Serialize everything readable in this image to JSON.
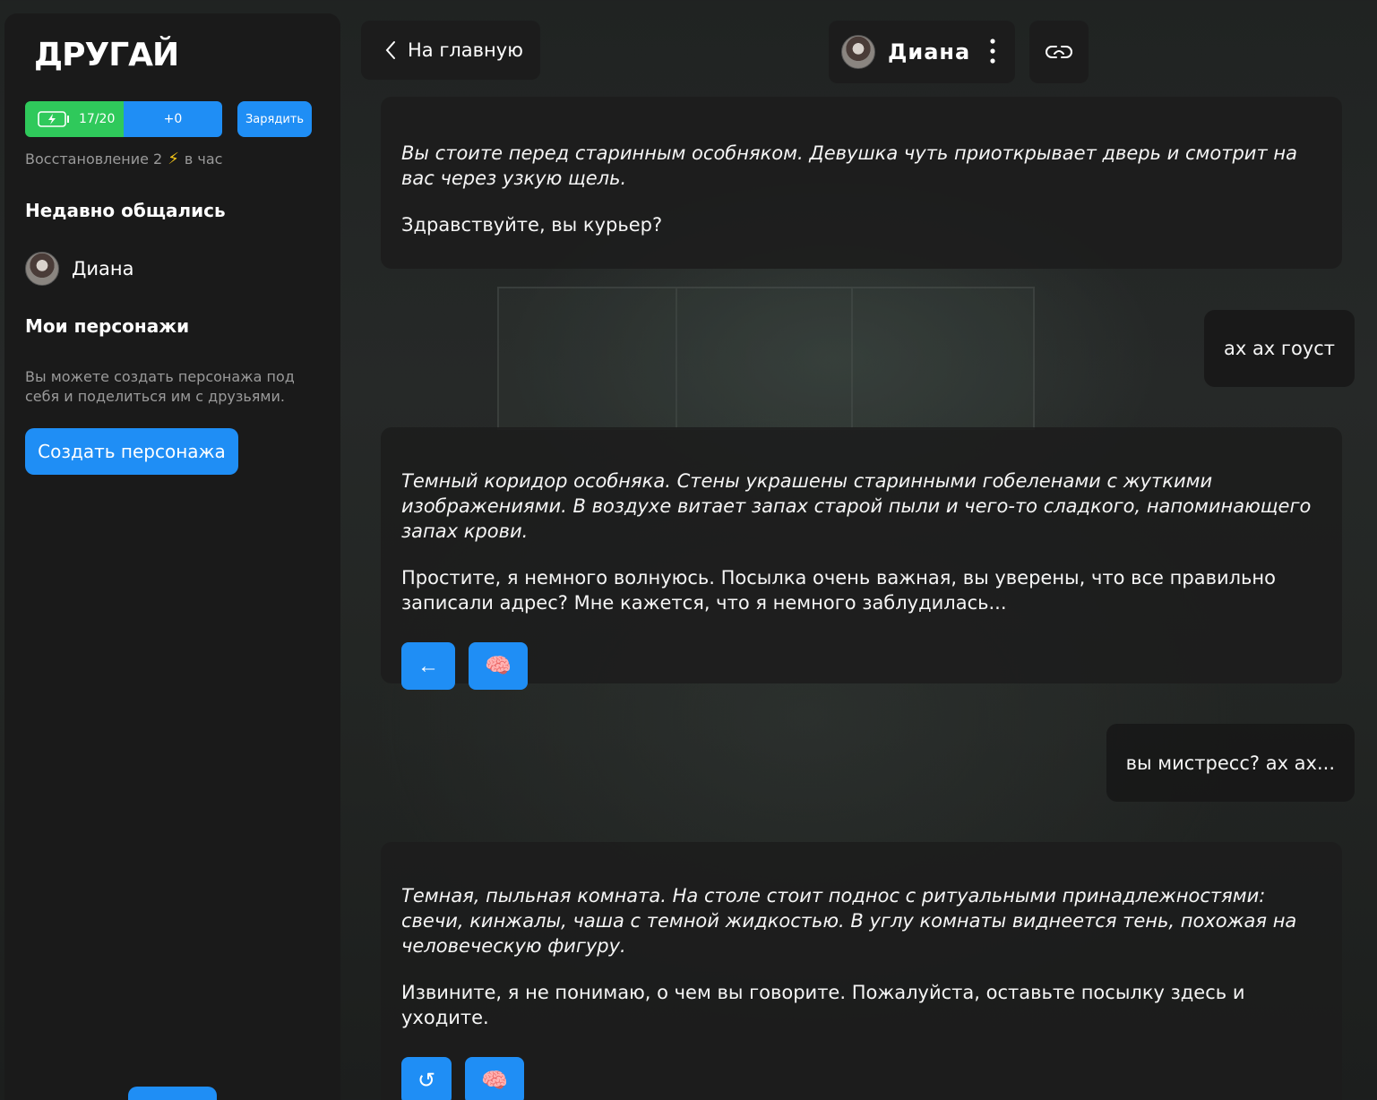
{
  "app": {
    "logo": "ДРУГАЙ"
  },
  "energy": {
    "current": "17/20",
    "bonus": "+0",
    "charge_label": "Зарядить"
  },
  "restore": {
    "prefix": "Восстановление 2",
    "bolt": "⚡",
    "suffix": "в час"
  },
  "sidebar": {
    "recent_title": "Недавно общались",
    "recent": [
      {
        "name": "Диана"
      }
    ],
    "my_chars_title": "Мои персонажи",
    "hint": "Вы можете создать персонажа под себя и поделиться им с друзьями.",
    "create_label": "Создать персонажа"
  },
  "topbar": {
    "back_label": "На главную",
    "character_name": "Диана"
  },
  "messages": [
    {
      "role": "bot",
      "narration": "Вы стоите перед старинным особняком. Девушка чуть приоткрывает дверь и смотрит на вас через узкую щель.",
      "speech": "Здравствуйте, вы курьер?"
    },
    {
      "role": "user",
      "text": "ах ах гоуст"
    },
    {
      "role": "bot",
      "narration": "Темный коридор особняка. Стены украшены старинными гобеленами с жуткими изображениями. В воздухе витает запах старой пыли и чего-то сладкого, напоминающего запах крови.",
      "speech": "Простите, я немного волнуюсь. Посылка очень важная, вы уверены, что все правильно записали адрес? Мне кажется, что я немного заблудилась...",
      "actions": [
        "←",
        "🧠"
      ]
    },
    {
      "role": "user",
      "text": "вы мистресс? ах ах..."
    },
    {
      "role": "bot",
      "narration": "Темная, пыльная комната. На столе стоит поднос с ритуальными принадлежностями: свечи, кинжалы, чаша с темной жидкостью. В углу комнаты виднеется тень, похожая на человеческую фигуру.",
      "speech": "Извините, я не понимаю, о чем вы говорите. Пожалуйста, оставьте посылку здесь и уходите.",
      "actions": [
        "↺",
        "🧠"
      ]
    }
  ],
  "colors": {
    "accent": "#1f8ef5",
    "energy": "#2fc95b",
    "panel": "#1a1a1a"
  }
}
